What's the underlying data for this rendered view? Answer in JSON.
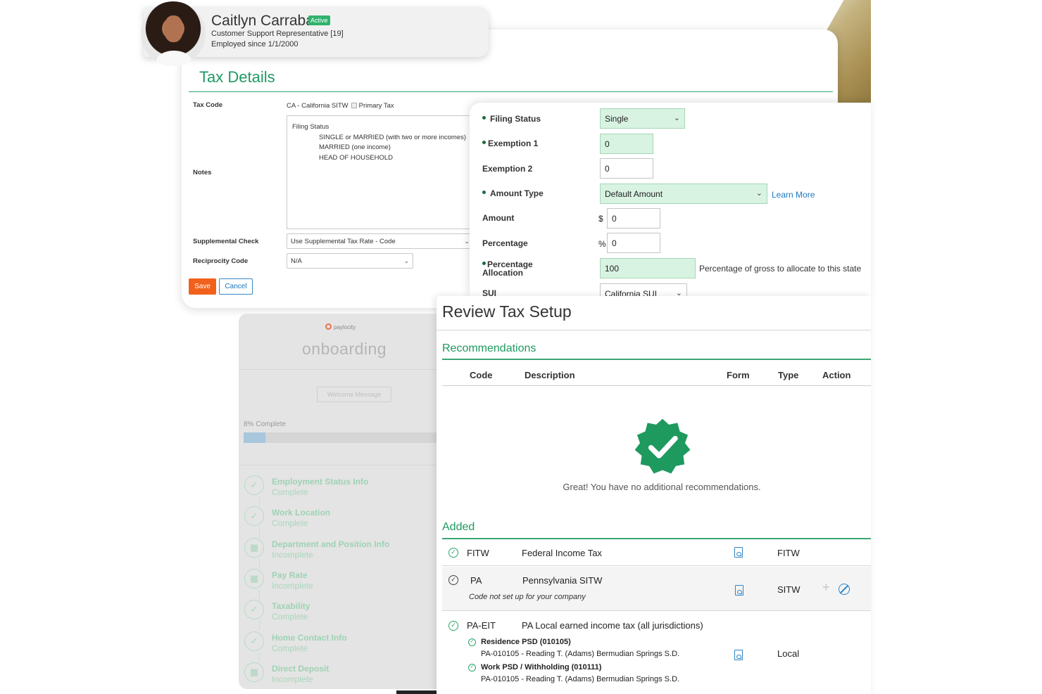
{
  "employee": {
    "name": "Caitlyn Carraba",
    "status_badge": "Active",
    "title": "Customer Support Representative [19]",
    "since": "Employed since 1/1/2000"
  },
  "tax_details": {
    "title": "Tax Details",
    "tax_code_label": "Tax Code",
    "tax_code_value": "CA - California SITW",
    "primary_tax_label": "Primary Tax",
    "notes_label": "Notes",
    "notes_lines": [
      "Filing Status",
      "SINGLE or MARRIED (with two or more incomes)",
      "MARRIED (one income)",
      "HEAD OF HOUSEHOLD"
    ],
    "supplemental_label": "Supplemental Check",
    "supplemental_value": "Use Supplemental Tax Rate - Code",
    "reciprocity_label": "Reciprocity Code",
    "reciprocity_value": "N/A",
    "save_label": "Save",
    "cancel_label": "Cancel"
  },
  "filing": {
    "filing_status_label": "Filing Status",
    "filing_status_value": "Single",
    "exemption1_label": "Exemption 1",
    "exemption1_value": "0",
    "exemption2_label": "Exemption 2",
    "exemption2_value": "0",
    "amount_type_label": "Amount Type",
    "amount_type_value": "Default Amount",
    "learn_more": "Learn More",
    "amount_label": "Amount",
    "amount_symbol": "$",
    "amount_value": "0",
    "percentage_label": "Percentage",
    "percentage_symbol": "%",
    "percentage_value": "0",
    "pct_alloc_label_1": "Percentage",
    "pct_alloc_label_2": "Allocation",
    "pct_alloc_value": "100",
    "pct_alloc_note": "Percentage of gross to allocate to this state",
    "sui_label": "SUI",
    "sui_value": "California SUI"
  },
  "onboarding": {
    "logo": "paylocity",
    "title": "onboarding",
    "welcome_button": "Welcome Message",
    "progress_label": "8% Complete",
    "progress": 0.08,
    "steps": [
      {
        "name": "Employment Status Info",
        "status": "Complete",
        "icon": "check-icon"
      },
      {
        "name": "Work Location",
        "status": "Complete",
        "icon": "check-icon"
      },
      {
        "name": "Department and Position Info",
        "status": "Incomplete",
        "icon": "calendar-icon"
      },
      {
        "name": "Pay Rate",
        "status": "Incomplete",
        "icon": "calendar-icon"
      },
      {
        "name": "Taxability",
        "status": "Complete",
        "icon": "check-icon"
      },
      {
        "name": "Home Contact Info",
        "status": "Complete",
        "icon": "check-icon"
      },
      {
        "name": "Direct Deposit",
        "status": "Incomplete",
        "icon": "calendar-icon"
      }
    ]
  },
  "review": {
    "title": "Review Tax Setup",
    "recommendations_heading": "Recommendations",
    "columns": {
      "code": "Code",
      "description": "Description",
      "form": "Form",
      "type": "Type",
      "action": "Action"
    },
    "no_recs_message": "Great! You have no additional recommendations.",
    "added_heading": "Added",
    "rows": [
      {
        "code": "FITW",
        "description": "Federal Income Tax",
        "type": "FITW"
      },
      {
        "code": "PA",
        "description": "Pennsylvania SITW",
        "type": "SITW",
        "note": "Code not set up for your company"
      },
      {
        "code": "PA-EIT",
        "description": "PA Local earned income tax (all jurisdictions)",
        "type": "Local",
        "sub": [
          {
            "title": "Residence PSD (010105)",
            "detail": "PA-010105 - Reading T. (Adams) Bermudian Springs S.D."
          },
          {
            "title": "Work PSD / Withholding (010111)",
            "detail": "PA-010105 - Reading T. (Adams) Bermudian Springs S.D."
          }
        ]
      }
    ]
  },
  "colors": {
    "accent_green": "#1e9a5f",
    "save_orange": "#f2611b",
    "link_blue": "#1b78c2",
    "field_green": "#d8f3e2"
  }
}
